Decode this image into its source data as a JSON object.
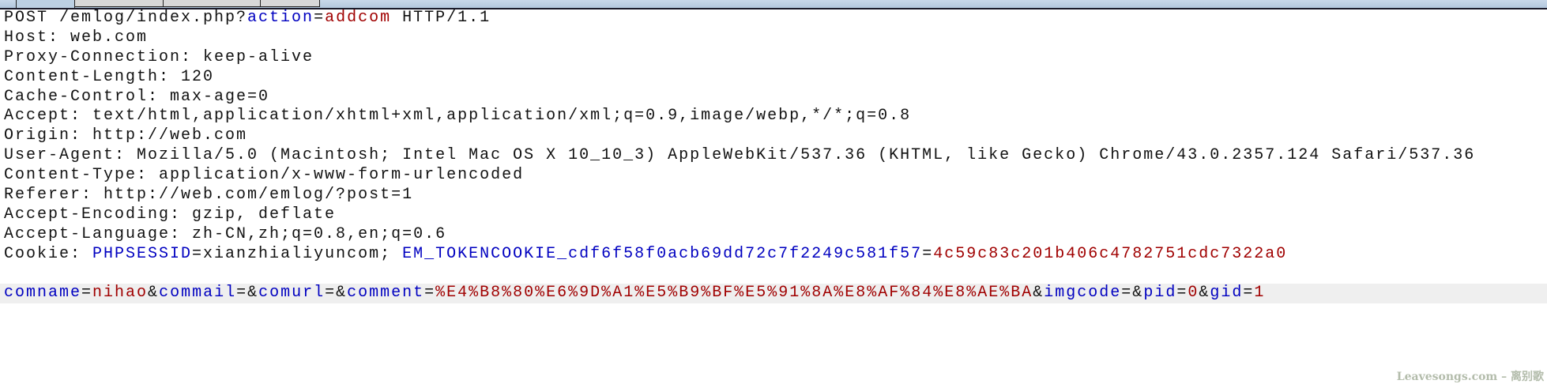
{
  "tabs": [
    {
      "label": "",
      "active": true
    },
    {
      "label": "",
      "active": false
    },
    {
      "label": "",
      "active": false
    },
    {
      "label": "",
      "active": false
    }
  ],
  "colors": {
    "param_name": "#0000c0",
    "param_value": "#a00000",
    "plain": "#111111",
    "highlight_row": "#efefef"
  },
  "request": {
    "lines": [
      {
        "segments": [
          [
            "POST /emlog/index.php?",
            "p"
          ],
          [
            "action",
            "k"
          ],
          [
            "=",
            "p"
          ],
          [
            "addcom",
            "v"
          ],
          [
            " HTTP/1.1",
            "p"
          ]
        ]
      },
      {
        "segments": [
          [
            "Host: web.com",
            "p"
          ]
        ]
      },
      {
        "segments": [
          [
            "Proxy-Connection: keep-alive",
            "p"
          ]
        ]
      },
      {
        "segments": [
          [
            "Content-Length: 120",
            "p"
          ]
        ]
      },
      {
        "segments": [
          [
            "Cache-Control: max-age=0",
            "p"
          ]
        ]
      },
      {
        "segments": [
          [
            "Accept: text/html,application/xhtml+xml,application/xml;q=0.9,image/webp,*/*;q=0.8",
            "p"
          ]
        ]
      },
      {
        "segments": [
          [
            "Origin: http://web.com",
            "p"
          ]
        ]
      },
      {
        "segments": [
          [
            "User-Agent: Mozilla/5.0 (Macintosh; Intel Mac OS X 10_10_3) AppleWebKit/537.36 (KHTML, like Gecko) Chrome/43.0.2357.124 Safari/537.36",
            "p"
          ]
        ]
      },
      {
        "segments": [
          [
            "Content-Type: application/x-www-form-urlencoded",
            "p"
          ]
        ]
      },
      {
        "segments": [
          [
            "Referer: http://web.com/emlog/?post=1",
            "p"
          ]
        ]
      },
      {
        "segments": [
          [
            "Accept-Encoding: gzip, deflate",
            "p"
          ]
        ]
      },
      {
        "segments": [
          [
            "Accept-Language: zh-CN,zh;q=0.8,en;q=0.6",
            "p"
          ]
        ]
      },
      {
        "segments": [
          [
            "Cookie: ",
            "p"
          ],
          [
            "PHPSESSID",
            "k"
          ],
          [
            "=xianzhialiyuncom; ",
            "p"
          ],
          [
            "EM_TOKENCOOKIE_cdf6f58f0acb69dd72c7f2249c581f57",
            "k"
          ],
          [
            "=",
            "p"
          ],
          [
            "4c59c83c201b406c4782751cdc7322a0",
            "v"
          ]
        ]
      },
      {
        "segments": [
          [
            "",
            "p"
          ]
        ]
      },
      {
        "highlight": true,
        "segments": [
          [
            "comname",
            "k"
          ],
          [
            "=",
            "p"
          ],
          [
            "nihao",
            "v"
          ],
          [
            "&",
            "p"
          ],
          [
            "commail",
            "k"
          ],
          [
            "=&",
            "p"
          ],
          [
            "comurl",
            "k"
          ],
          [
            "=&",
            "p"
          ],
          [
            "comment",
            "k"
          ],
          [
            "=",
            "p"
          ],
          [
            "%E4%B8%80%E6%9D%A1%E5%B9%BF%E5%91%8A%E8%AF%84%E8%AE%BA",
            "v"
          ],
          [
            "&",
            "p"
          ],
          [
            "imgcode",
            "k"
          ],
          [
            "=&",
            "p"
          ],
          [
            "pid",
            "k"
          ],
          [
            "=",
            "p"
          ],
          [
            "0",
            "v"
          ],
          [
            "&",
            "p"
          ],
          [
            "gid",
            "k"
          ],
          [
            "=",
            "p"
          ],
          [
            "1",
            "v"
          ]
        ]
      }
    ]
  },
  "watermark": "Leavesongs.com – 离别歌"
}
